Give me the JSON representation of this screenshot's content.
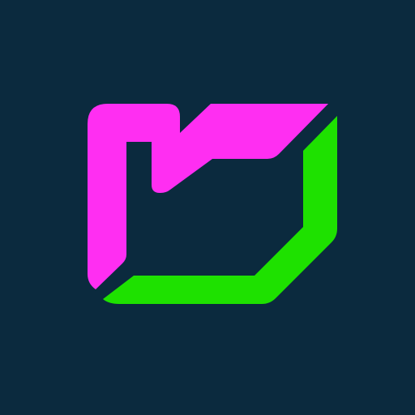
{
  "background": "#0b2a3e",
  "logo": {
    "name": "app-logo",
    "colors": {
      "magenta": "#ff2ef2",
      "green": "#1ee100"
    }
  }
}
